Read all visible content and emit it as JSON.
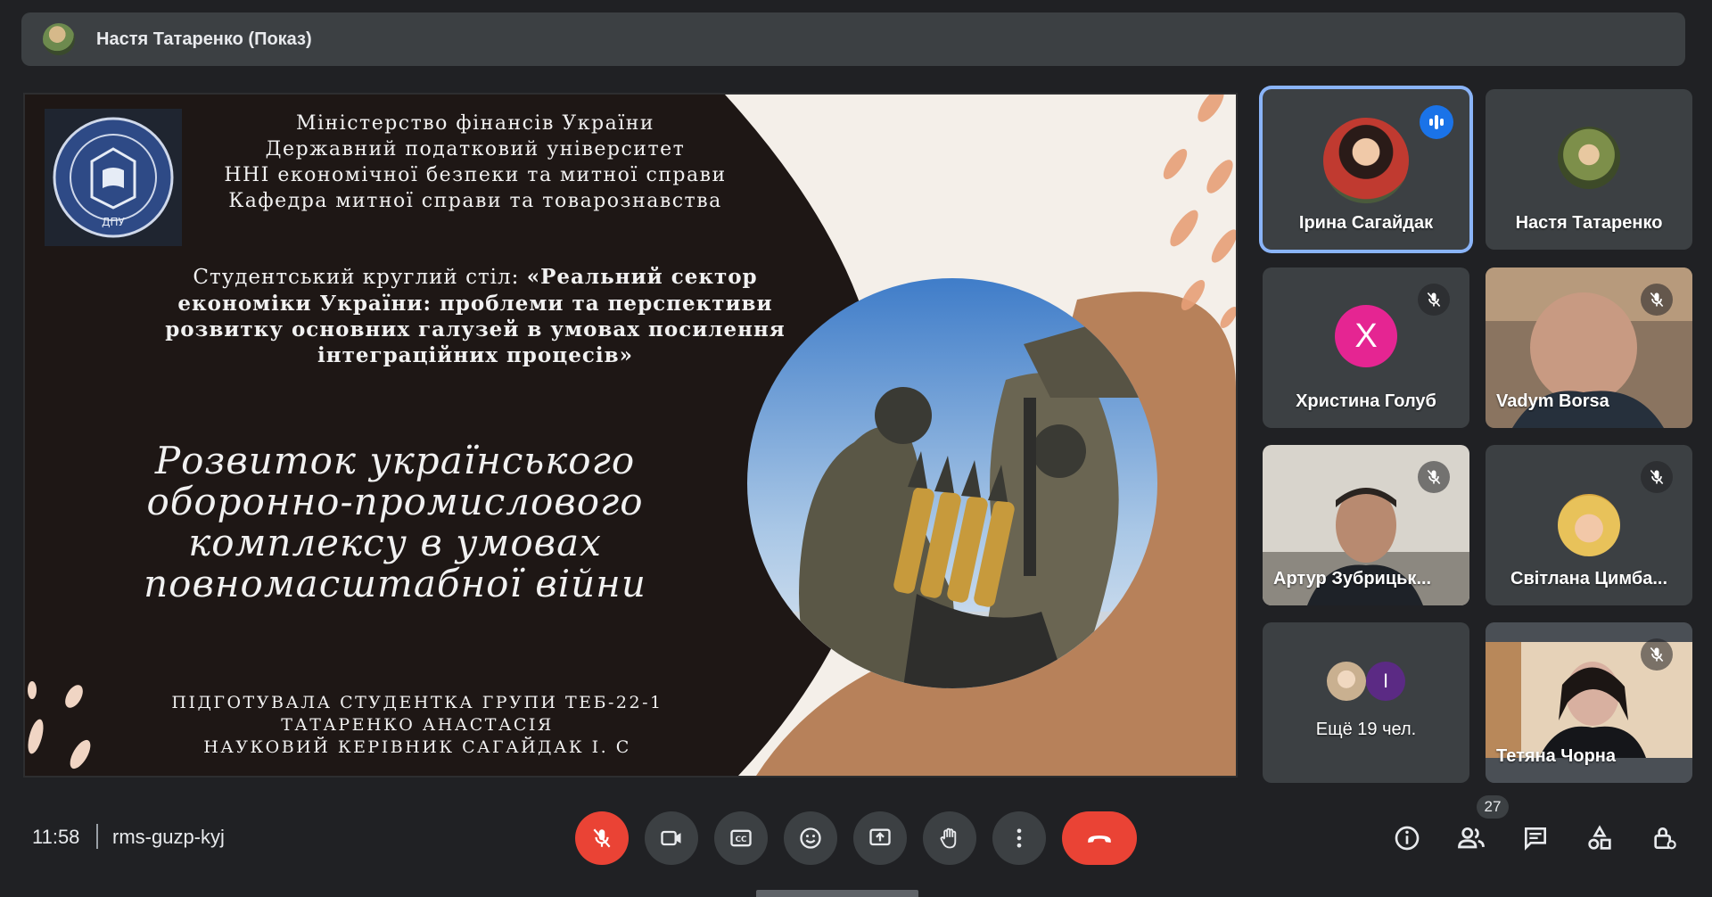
{
  "presenter_bar": {
    "title": "Настя Татаренко (Показ)"
  },
  "slide": {
    "ministry_lines": [
      "Міністерство фінансів України",
      "Державний податковий університет",
      "ННІ економічної безпеки та митної справи",
      "Кафедра митної справи та товарознавства"
    ],
    "roundtable_lead": "Студентський круглий стіл: ",
    "roundtable_title": "«Реальний сектор економіки України: проблеми та перспективи розвитку основних галузей в умовах посилення інтеграційних процесів»",
    "main_title": "Розвиток українського оборонно-промислового комплексу в умовах повномасштабної війни",
    "credits": [
      "ПІДГОТУВАЛА СТУДЕНТКА ГРУПИ ТЕБ-22-1",
      "ТАТАРЕНКО АНАСТАСІЯ",
      "НАУКОВИЙ КЕРІВНИК САГАЙДАК І. С"
    ],
    "logo_text": "ДПУ",
    "colors": {
      "dark": "#1e1715",
      "accent": "#b7815a",
      "light": "#f4efe9"
    }
  },
  "participants": [
    {
      "name": "Ірина Сагайдак",
      "state": "speaking"
    },
    {
      "name": "Настя Татаренко",
      "state": "avatar"
    },
    {
      "name": "Христина Голуб",
      "state": "muted",
      "initial": "Х",
      "color": "#e52592"
    },
    {
      "name": "Vadym Borsa",
      "state": "muted-video"
    },
    {
      "name": "Артур Зубрицьк...",
      "state": "muted-video"
    },
    {
      "name": "Світлана Цимба...",
      "state": "muted"
    },
    {
      "name": "Ещё 19 чел.",
      "state": "more",
      "initial": "І"
    },
    {
      "name": "Тетяна Чорна",
      "state": "muted-video"
    }
  ],
  "bottom": {
    "time": "11:58",
    "meeting_code": "rms-guzp-kyj",
    "participant_count": "27",
    "controls": [
      "mic-off-icon",
      "camera-icon",
      "captions-icon",
      "emoji-icon",
      "present-icon",
      "raise-hand-icon",
      "more-icon",
      "hang-up-icon"
    ],
    "right_icons": [
      "info-icon",
      "people-icon",
      "chat-icon",
      "activities-icon",
      "host-controls-icon"
    ]
  }
}
